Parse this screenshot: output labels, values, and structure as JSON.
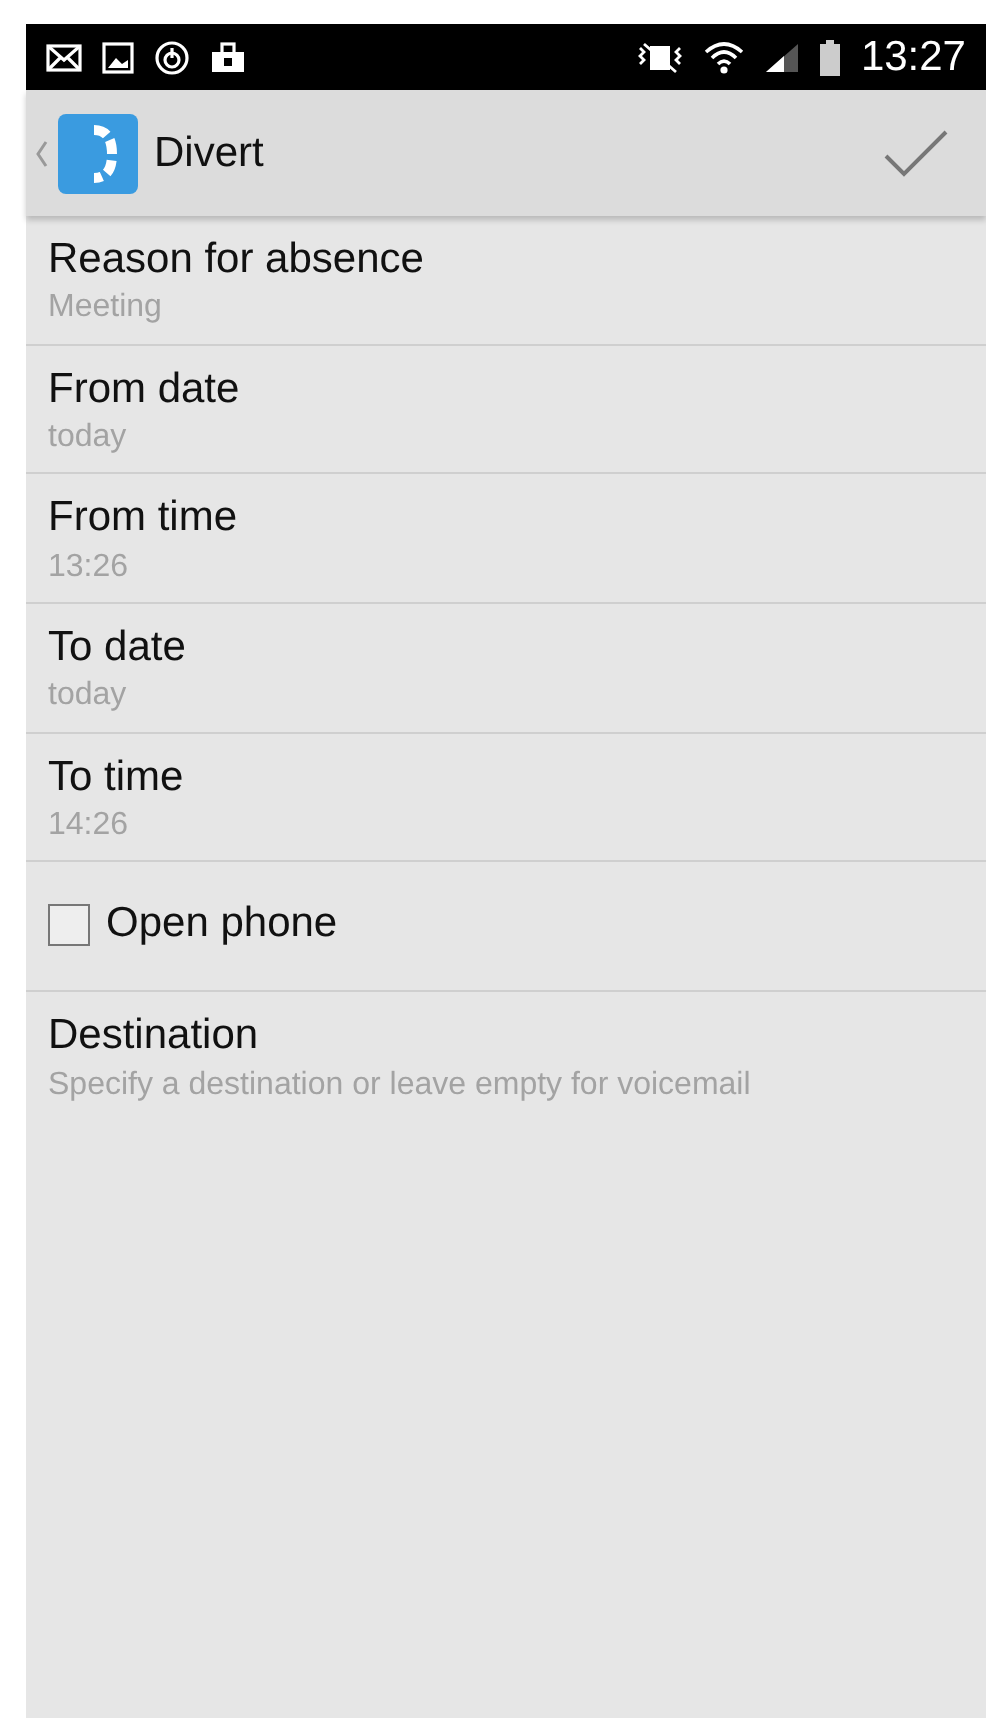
{
  "status_bar": {
    "time": "13:27"
  },
  "action_bar": {
    "title": "Divert"
  },
  "items": [
    {
      "kind": "setting",
      "title": "Reason for absence",
      "summary": "Meeting"
    },
    {
      "kind": "setting",
      "title": "From date",
      "summary": "today"
    },
    {
      "kind": "setting",
      "title": "From time",
      "summary": "13:26"
    },
    {
      "kind": "setting",
      "title": "To date",
      "summary": "today"
    },
    {
      "kind": "setting",
      "title": "To time",
      "summary": "14:26"
    },
    {
      "kind": "checkbox",
      "label": "Open phone",
      "checked": false
    },
    {
      "kind": "field",
      "title": "Destination",
      "placeholder": "Specify a destination or leave empty for voicemail"
    }
  ]
}
